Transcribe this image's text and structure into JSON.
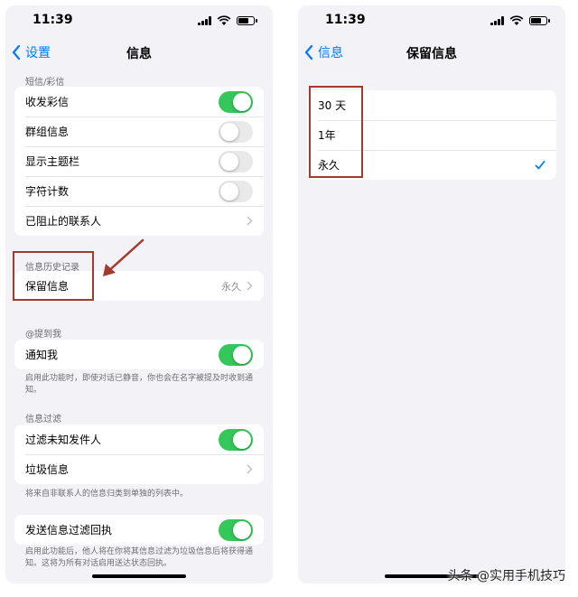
{
  "status": {
    "time": "11:39"
  },
  "left": {
    "back_label": "设置",
    "title": "信息",
    "sms_header": "短信/彩信",
    "sms_rows": [
      {
        "label": "收发彩信",
        "toggle": true
      },
      {
        "label": "群组信息",
        "toggle": false
      },
      {
        "label": "显示主题栏",
        "toggle": false
      },
      {
        "label": "字符计数",
        "toggle": false
      },
      {
        "label": "已阻止的联系人",
        "chevron": true
      }
    ],
    "history_header": "信息历史记录",
    "keep_messages": {
      "label": "保留信息",
      "value": "永久"
    },
    "mention_header": "@提到我",
    "notify_me": {
      "label": "通知我",
      "toggle": true
    },
    "notify_footnote": "启用此功能时，即使对话已静音，你也会在名字被提及时收到通知。",
    "filter_header": "信息过滤",
    "filter_unknown": {
      "label": "过滤未知发件人",
      "toggle": true
    },
    "junk": {
      "label": "垃圾信息"
    },
    "filter_footnote": "将来自非联系人的信息归类到单独的列表中。",
    "send_receipts": {
      "label": "发送信息过滤回执",
      "toggle": true
    },
    "receipts_footnote": "启用此功能后，他人将在你将其信息过滤为垃圾信息后将获得通知。这将为所有对话启用送达状态回执。"
  },
  "right": {
    "back_label": "信息",
    "title": "保留信息",
    "options": [
      {
        "label": "30 天",
        "selected": false
      },
      {
        "label": "1年",
        "selected": false
      },
      {
        "label": "永久",
        "selected": true
      }
    ]
  },
  "colors": {
    "accent": "#007aff",
    "toggle_on": "#34c759",
    "annotation": "#a33a2e"
  },
  "watermark": "头条 @实用手机技巧"
}
